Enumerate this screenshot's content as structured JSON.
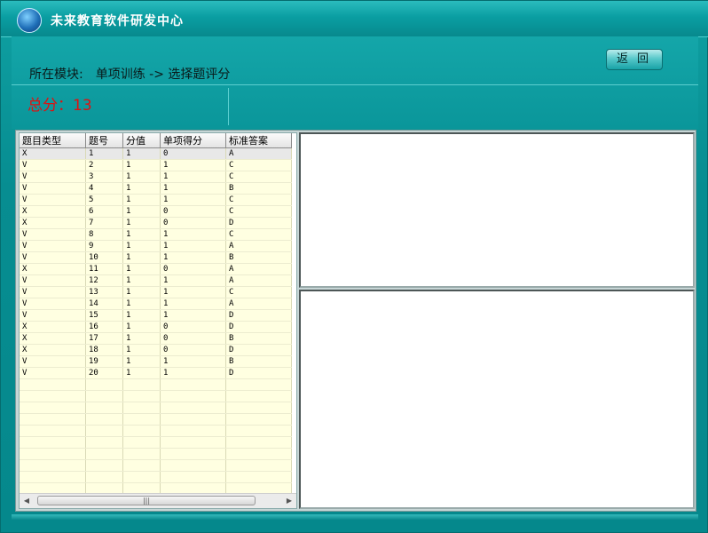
{
  "app": {
    "title": "未来教育软件研发中心",
    "logo_text": "未来教育"
  },
  "header": {
    "module_label": "所在模块:",
    "module_path": "单项训练 -> 选择题评分",
    "score_text": "总分：13",
    "back_button": "返回"
  },
  "grid": {
    "columns": [
      "题目类型",
      "题号",
      "分值",
      "单项得分",
      "标准答案"
    ],
    "rows": [
      {
        "type": "X",
        "no": "1",
        "value": "1",
        "score": "0",
        "answer": "A"
      },
      {
        "type": "V",
        "no": "2",
        "value": "1",
        "score": "1",
        "answer": "C"
      },
      {
        "type": "V",
        "no": "3",
        "value": "1",
        "score": "1",
        "answer": "C"
      },
      {
        "type": "V",
        "no": "4",
        "value": "1",
        "score": "1",
        "answer": "B"
      },
      {
        "type": "V",
        "no": "5",
        "value": "1",
        "score": "1",
        "answer": "C"
      },
      {
        "type": "X",
        "no": "6",
        "value": "1",
        "score": "0",
        "answer": "C"
      },
      {
        "type": "X",
        "no": "7",
        "value": "1",
        "score": "0",
        "answer": "D"
      },
      {
        "type": "V",
        "no": "8",
        "value": "1",
        "score": "1",
        "answer": "C"
      },
      {
        "type": "V",
        "no": "9",
        "value": "1",
        "score": "1",
        "answer": "A"
      },
      {
        "type": "V",
        "no": "10",
        "value": "1",
        "score": "1",
        "answer": "B"
      },
      {
        "type": "X",
        "no": "11",
        "value": "1",
        "score": "0",
        "answer": "A"
      },
      {
        "type": "V",
        "no": "12",
        "value": "1",
        "score": "1",
        "answer": "A"
      },
      {
        "type": "V",
        "no": "13",
        "value": "1",
        "score": "1",
        "answer": "C"
      },
      {
        "type": "V",
        "no": "14",
        "value": "1",
        "score": "1",
        "answer": "A"
      },
      {
        "type": "V",
        "no": "15",
        "value": "1",
        "score": "1",
        "answer": "D"
      },
      {
        "type": "X",
        "no": "16",
        "value": "1",
        "score": "0",
        "answer": "D"
      },
      {
        "type": "X",
        "no": "17",
        "value": "1",
        "score": "0",
        "answer": "B"
      },
      {
        "type": "X",
        "no": "18",
        "value": "1",
        "score": "0",
        "answer": "D"
      },
      {
        "type": "V",
        "no": "19",
        "value": "1",
        "score": "1",
        "answer": "B"
      },
      {
        "type": "V",
        "no": "20",
        "value": "1",
        "score": "1",
        "answer": "D"
      }
    ],
    "empty_rows": 10,
    "scroll_thumb_glyph": "|||"
  },
  "colors": {
    "correct": "#1030c0",
    "wrong": "#d01010",
    "score": "#e01010"
  }
}
